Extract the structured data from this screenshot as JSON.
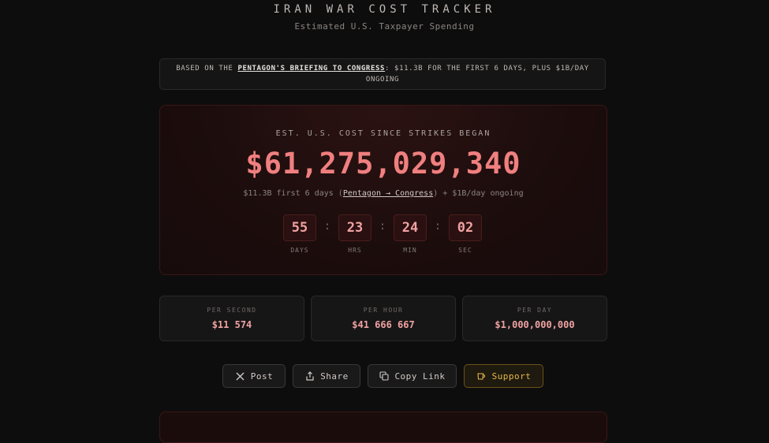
{
  "header": {
    "title": "IRAN WAR COST TRACKER",
    "subtitle": "Estimated U.S. Taxpayer Spending"
  },
  "notice": {
    "prefix": "BASED ON THE ",
    "link": "PENTAGON'S BRIEFING TO CONGRESS",
    "suffix": ": $11.3B FOR THE FIRST 6 DAYS, PLUS $1B/DAY ONGOING"
  },
  "hero": {
    "label": "EST. U.S. COST SINCE STRIKES BEGAN",
    "amount": "$61,275,029,340",
    "note_prefix": "$11.3B first 6 days (",
    "note_link": "Pentagon → Congress",
    "note_suffix": ") + $1B/day ongoing"
  },
  "timer": {
    "days": "55",
    "days_label": "DAYS",
    "hours": "23",
    "hours_label": "HRS",
    "minutes": "24",
    "minutes_label": "MIN",
    "seconds": "02",
    "seconds_label": "SEC",
    "separator": ":"
  },
  "stats": [
    {
      "label": "PER SECOND",
      "value": "$11 574"
    },
    {
      "label": "PER HOUR",
      "value": "$41 666 667"
    },
    {
      "label": "PER DAY",
      "value": "$1,000,000,000"
    }
  ],
  "actions": {
    "post": "Post",
    "share": "Share",
    "copy": "Copy Link",
    "support": "Support"
  },
  "colors": {
    "accent": "#f07f7f",
    "support": "#e6b84a",
    "background": "#0e0d0d"
  },
  "icons": {
    "post": "x-logo-icon",
    "share": "share-icon",
    "copy": "copy-icon",
    "support": "coffee-icon"
  }
}
